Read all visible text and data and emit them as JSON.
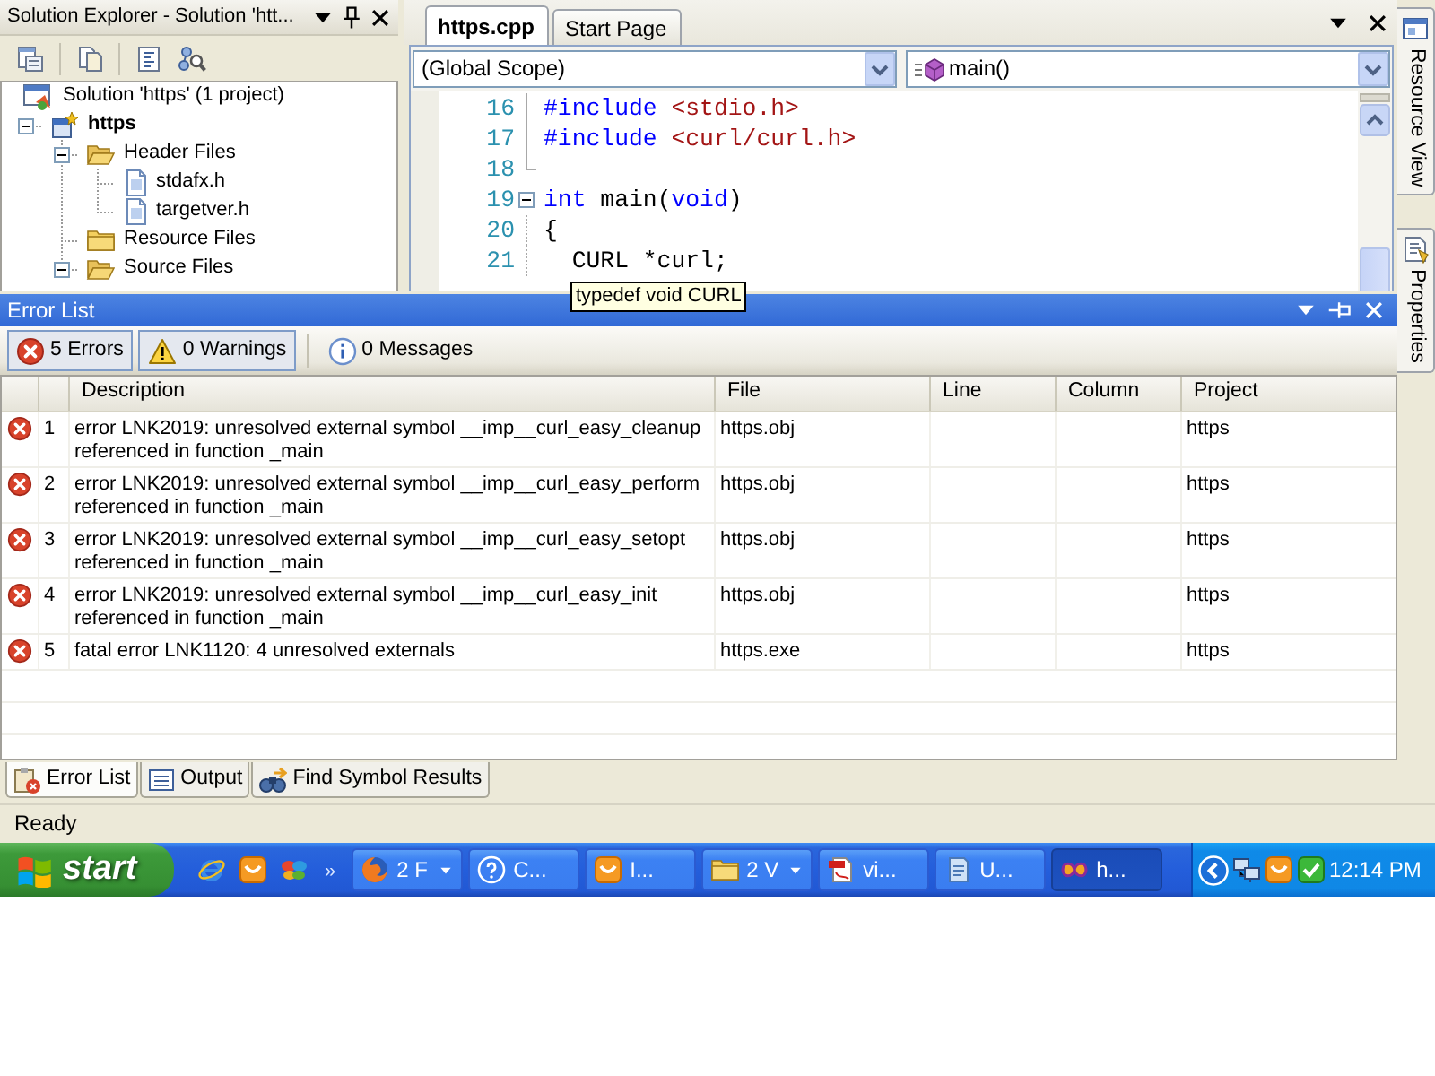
{
  "solution_explorer": {
    "title": "Solution Explorer - Solution 'htt...",
    "tree": [
      {
        "label": "Solution 'https' (1 project)",
        "kind": "solution",
        "children": [
          {
            "label": "https",
            "kind": "project",
            "expanded": true,
            "children": [
              {
                "label": "Header Files",
                "kind": "folder",
                "expanded": true,
                "children": [
                  {
                    "label": "stdafx.h",
                    "kind": "file"
                  },
                  {
                    "label": "targetver.h",
                    "kind": "file"
                  }
                ]
              },
              {
                "label": "Resource Files",
                "kind": "folder"
              },
              {
                "label": "Source Files",
                "kind": "folder",
                "expanded": true
              }
            ]
          }
        ]
      }
    ]
  },
  "editor": {
    "tabs": [
      {
        "label": "https.cpp",
        "selected": true
      },
      {
        "label": "Start Page",
        "selected": false
      }
    ],
    "scope": "(Global Scope)",
    "member": "main()",
    "lines": [
      {
        "number": "16",
        "kind": "bar",
        "tokens": [
          {
            "kind": "keyword",
            "text": "#include"
          },
          {
            "kind": "string",
            "text": " <stdio.h>"
          }
        ]
      },
      {
        "number": "17",
        "kind": "bar",
        "tokens": [
          {
            "kind": "keyword",
            "text": "#include"
          },
          {
            "kind": "string",
            "text": " <curl/curl.h>"
          }
        ]
      },
      {
        "number": "18",
        "kind": "end"
      },
      {
        "number": "19",
        "kind": "start",
        "tokens": [
          {
            "kind": "keyword",
            "text": "int"
          },
          {
            "kind": "plain",
            "text": " main("
          },
          {
            "kind": "keyword",
            "text": "void"
          },
          {
            "kind": "plain",
            "text": ")"
          }
        ]
      },
      {
        "number": "20",
        "kind": "bar",
        "tokens": [
          {
            "kind": "plain",
            "text": "{"
          }
        ]
      },
      {
        "number": "21",
        "kind": "bar",
        "tokens": [
          {
            "kind": "plain",
            "text": "  CURL *curl;"
          }
        ]
      }
    ],
    "tooltip": "typedef void CURL"
  },
  "side_tabs": [
    {
      "label": "Resource View",
      "kind": "resources"
    },
    {
      "label": "Properties",
      "kind": "properties"
    }
  ],
  "error_list": {
    "title": "Error List",
    "filters": [
      {
        "kind": "error",
        "label": "5 Errors",
        "selected": true
      },
      {
        "kind": "warning",
        "label": "0 Warnings",
        "selected": true
      },
      {
        "kind": "message",
        "label": "0 Messages",
        "selected": false
      }
    ],
    "columns": [
      "Description",
      "File",
      "Line",
      "Column",
      "Project"
    ],
    "rows": [
      {
        "kind": "error",
        "number": "1",
        "description": "error LNK2019: unresolved external symbol __imp__curl_easy_cleanup referenced in function _main",
        "file": "https.obj",
        "project": "https"
      },
      {
        "kind": "error",
        "number": "2",
        "description": "error LNK2019: unresolved external symbol __imp__curl_easy_perform referenced in function _main",
        "file": "https.obj",
        "project": "https"
      },
      {
        "kind": "error",
        "number": "3",
        "description": "error LNK2019: unresolved external symbol __imp__curl_easy_setopt referenced in function _main",
        "file": "https.obj",
        "project": "https"
      },
      {
        "kind": "error",
        "number": "4",
        "description": "error LNK2019: unresolved external symbol __imp__curl_easy_init referenced in function _main",
        "file": "https.obj",
        "project": "https"
      },
      {
        "kind": "error",
        "number": "5",
        "description": "fatal error LNK1120: 4 unresolved externals",
        "file": "https.exe",
        "project": "https"
      }
    ],
    "tabs": [
      {
        "kind": "errors",
        "label": "Error List",
        "selected": true
      },
      {
        "kind": "output",
        "label": "Output",
        "selected": false
      },
      {
        "kind": "symbols",
        "label": "Find Symbol Results",
        "selected": false
      }
    ]
  },
  "status_bar": "Ready",
  "taskbar": {
    "start": "start",
    "more": "»",
    "tasks": [
      {
        "kind": "browser",
        "label": "2 F",
        "grouped": true,
        "selected": false
      },
      {
        "kind": "help",
        "label": "C...",
        "grouped": false,
        "selected": false
      },
      {
        "kind": "messenger",
        "label": "I...",
        "grouped": false,
        "selected": false
      },
      {
        "kind": "folder",
        "label": "2 V",
        "grouped": true,
        "selected": false
      },
      {
        "kind": "pdf",
        "label": "vi...",
        "grouped": false,
        "selected": false
      },
      {
        "kind": "notepad",
        "label": "U...",
        "grouped": false,
        "selected": false
      },
      {
        "kind": "studio",
        "label": "h...",
        "grouped": false,
        "selected": true
      }
    ],
    "clock": "12:14 PM"
  }
}
